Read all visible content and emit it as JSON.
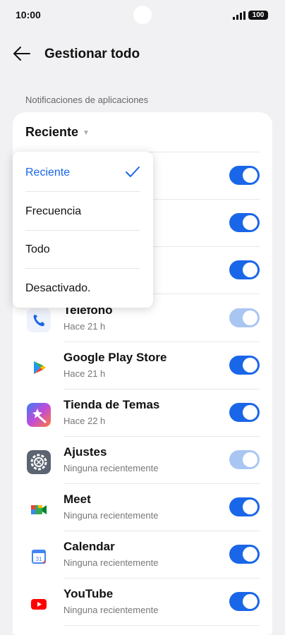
{
  "status_bar": {
    "time": "10:00",
    "battery": "100"
  },
  "header": {
    "title": "Gestionar todo"
  },
  "section_label": "Notificaciones de aplicaciones",
  "filter": {
    "selected": "Reciente"
  },
  "dropdown": {
    "options": [
      "Reciente",
      "Frecuencia",
      "Todo",
      "Desactivado."
    ],
    "selected_index": 0
  },
  "apps": [
    {
      "name": "",
      "subtitle": "",
      "enabled": true
    },
    {
      "name": "",
      "subtitle": "",
      "enabled": true
    },
    {
      "name": "",
      "subtitle": "",
      "enabled": true
    },
    {
      "name": "Teléfono",
      "subtitle": "Hace 21 h",
      "enabled": true,
      "disabled": true
    },
    {
      "name": "Google Play Store",
      "subtitle": "Hace 21 h",
      "enabled": true
    },
    {
      "name": "Tienda de Temas",
      "subtitle": "Hace 22 h",
      "enabled": true
    },
    {
      "name": "Ajustes",
      "subtitle": "Ninguna recientemente",
      "enabled": true,
      "disabled": true
    },
    {
      "name": "Meet",
      "subtitle": "Ninguna recientemente",
      "enabled": true
    },
    {
      "name": "Calendar",
      "subtitle": "Ninguna recientemente",
      "enabled": true
    },
    {
      "name": "YouTube",
      "subtitle": "Ninguna recientemente",
      "enabled": true
    }
  ],
  "icons": {
    "back": "arrow-left-icon",
    "check": "checkmark-icon",
    "caret": "caret-down-icon"
  },
  "colors": {
    "accent": "#1a66e8",
    "toggle_disabled": "#a9c6f3"
  }
}
